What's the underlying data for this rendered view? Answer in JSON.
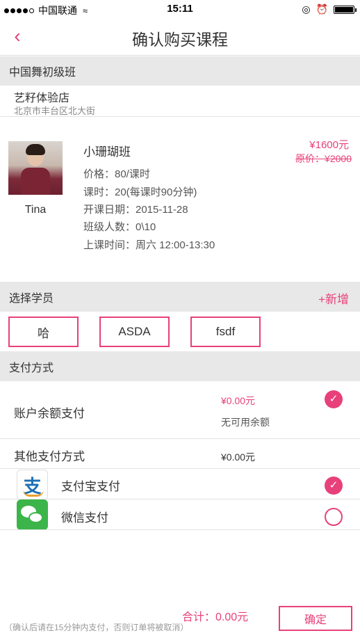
{
  "status_bar": {
    "carrier": "中国联通",
    "time": "15:11"
  },
  "nav": {
    "back_icon": "chevron-left-icon",
    "title": "确认购买课程"
  },
  "course_section": {
    "header": "中国舞初级班",
    "store_name": "艺籽体验店",
    "store_address": "北京市丰台区北大街"
  },
  "course": {
    "teacher_name": "Tina",
    "class_name": "小珊瑚班",
    "price_line": "价格：80/课时",
    "hours_line": "课时：20(每课时90分钟)",
    "start_date_line": "开课日期：2015-11-28",
    "capacity_line": "班级人数：0\\10",
    "schedule_line": "上课时间：周六 12:00-13:30",
    "price_now": "¥1600元",
    "price_original": "原价：¥2000"
  },
  "students": {
    "header": "选择学员",
    "add_label": "+新增",
    "items": [
      "哈",
      "ASDA",
      "fsdf"
    ]
  },
  "payment": {
    "header": "支付方式",
    "balance_label": "账户余额支付",
    "balance_amount": "¥0.00元",
    "balance_note": "无可用余额",
    "other_label": "其他支付方式",
    "other_amount": "¥0.00元",
    "alipay_label": "支付宝支付",
    "wechat_label": "微信支付"
  },
  "footer": {
    "total": "合计：0.00元",
    "confirm_label": "确定",
    "note": "（确认后请在15分钟内支付，否则订单将被取消）"
  },
  "colors": {
    "accent": "#e8407a",
    "section_bg": "#e8e8e8"
  }
}
